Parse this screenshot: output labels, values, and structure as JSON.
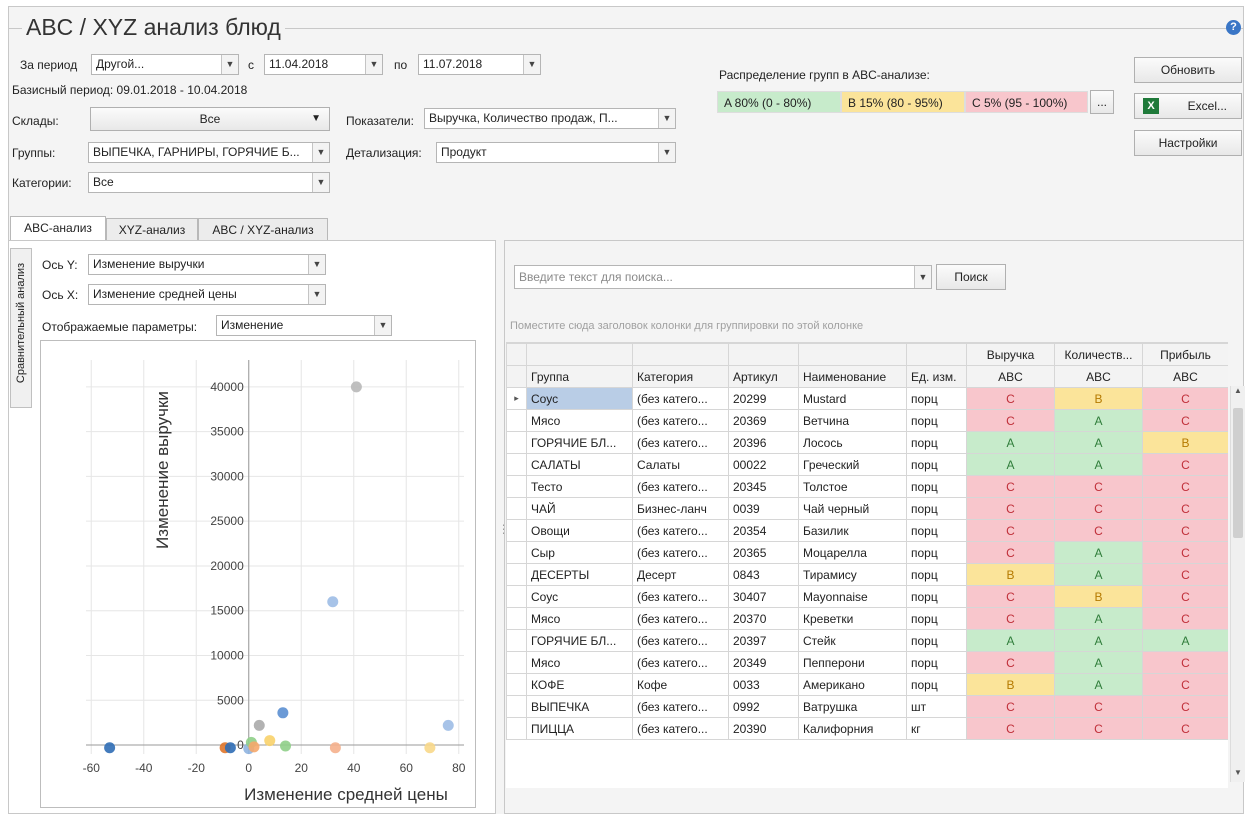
{
  "title": "ABC / XYZ анализ блюд",
  "help_icon": "?",
  "filters": {
    "period_label": "За период",
    "period_value": "Другой...",
    "from_label": "с",
    "from_value": "11.04.2018",
    "to_label": "по",
    "to_value": "11.07.2018",
    "base_period": "Базисный период: 09.01.2018 - 10.04.2018",
    "stores_label": "Склады:",
    "stores_value": "Все",
    "groups_label": "Группы:",
    "groups_value": "ВЫПЕЧКА, ГАРНИРЫ, ГОРЯЧИЕ Б...",
    "categories_label": "Категории:",
    "categories_value": "Все",
    "indicators_label": "Показатели:",
    "indicators_value": "Выручка, Количество продаж, П...",
    "detail_label": "Детализация:",
    "detail_value": "Продукт"
  },
  "distribution": {
    "label": "Распределение групп в ABC-анализе:",
    "a": "A 80% (0 - 80%)",
    "b": "B 15% (80 - 95%)",
    "c": "C 5% (95 - 100%)",
    "more": "...",
    "colors": {
      "A": "#c7ebcb",
      "B": "#fbe49a",
      "C": "#f8c6cc"
    }
  },
  "buttons": {
    "refresh": "Обновить",
    "excel": "Excel...",
    "settings": "Настройки"
  },
  "tabs": [
    "ABC-анализ",
    "XYZ-анализ",
    "ABC / XYZ-анализ"
  ],
  "left": {
    "vertical_tab": "Сравнительный анализ",
    "y_axis_label": "Ось Y:",
    "y_axis_value": "Изменение выручки",
    "x_axis_label": "Ось X:",
    "x_axis_value": "Изменение средней цены",
    "params_label": "Отображаемые параметры:",
    "params_value": "Изменение"
  },
  "chart_data": {
    "type": "scatter",
    "xlabel": "Изменение средней цены",
    "ylabel": "Изменение выручки",
    "xlim": [
      -62,
      82
    ],
    "ylim": [
      -1000,
      43000
    ],
    "xticks": [
      -60,
      -40,
      -20,
      0,
      20,
      40,
      60,
      80
    ],
    "yticks": [
      0,
      5000,
      10000,
      15000,
      20000,
      25000,
      30000,
      35000,
      40000
    ],
    "grid": true,
    "points": [
      {
        "x": -53,
        "y": -300,
        "color": "#2f6db5"
      },
      {
        "x": -9,
        "y": -300,
        "color": "#e0762a"
      },
      {
        "x": -7,
        "y": -300,
        "color": "#2f6db5"
      },
      {
        "x": 0,
        "y": -400,
        "color": "#8fb4e0"
      },
      {
        "x": 1,
        "y": 300,
        "color": "#8fcf88"
      },
      {
        "x": 2,
        "y": -200,
        "color": "#f5a86b"
      },
      {
        "x": 4,
        "y": 2200,
        "color": "#aaaaaa"
      },
      {
        "x": 8,
        "y": 500,
        "color": "#f8d26a"
      },
      {
        "x": 13,
        "y": 3600,
        "color": "#5b8fd1"
      },
      {
        "x": 14,
        "y": -100,
        "color": "#8fcf88"
      },
      {
        "x": 33,
        "y": -300,
        "color": "#f5b08c"
      },
      {
        "x": 32,
        "y": 16000,
        "color": "#9dbce6"
      },
      {
        "x": 41,
        "y": 40000,
        "color": "#b8b8b8"
      },
      {
        "x": 69,
        "y": -300,
        "color": "#f8d88a"
      },
      {
        "x": 76,
        "y": 2200,
        "color": "#9dbce6"
      }
    ]
  },
  "grid": {
    "search_placeholder": "Введите текст для поиска...",
    "search_button": "Поиск",
    "group_hint": "Поместите сюда заголовок колонки для группировки по этой колонке",
    "top_headers": [
      "Выручка",
      "Количеств...",
      "Прибыль"
    ],
    "columns": [
      "Группа",
      "Категория",
      "Артикул",
      "Наименование",
      "Ед. изм.",
      "ABC",
      "ABC",
      "ABC"
    ],
    "rows": [
      [
        "Соус",
        "(без катего...",
        "20299",
        "Mustard",
        "порц",
        "C",
        "B",
        "C"
      ],
      [
        "Мясо",
        "(без катего...",
        "20369",
        "Ветчина",
        "порц",
        "C",
        "A",
        "C"
      ],
      [
        "ГОРЯЧИЕ БЛ...",
        "(без катего...",
        "20396",
        "Лосось",
        "порц",
        "A",
        "A",
        "B"
      ],
      [
        "САЛАТЫ",
        "Салаты",
        "00022",
        "Греческий",
        "порц",
        "A",
        "A",
        "C"
      ],
      [
        "Тесто",
        "(без катего...",
        "20345",
        "Толстое",
        "порц",
        "C",
        "C",
        "C"
      ],
      [
        "ЧАЙ",
        "Бизнес-ланч",
        "0039",
        "Чай черный",
        "порц",
        "C",
        "C",
        "C"
      ],
      [
        "Овощи",
        "(без катего...",
        "20354",
        "Базилик",
        "порц",
        "C",
        "C",
        "C"
      ],
      [
        "Сыр",
        "(без катего...",
        "20365",
        "Моцарелла",
        "порц",
        "C",
        "A",
        "C"
      ],
      [
        "ДЕСЕРТЫ",
        "Десерт",
        "0843",
        "Тирамису",
        "порц",
        "B",
        "A",
        "C"
      ],
      [
        "Соус",
        "(без катего...",
        "30407",
        "Mayonnaise",
        "порц",
        "C",
        "B",
        "C"
      ],
      [
        "Мясо",
        "(без катего...",
        "20370",
        "Креветки",
        "порц",
        "C",
        "A",
        "C"
      ],
      [
        "ГОРЯЧИЕ БЛ...",
        "(без катего...",
        "20397",
        "Стейк",
        "порц",
        "A",
        "A",
        "A"
      ],
      [
        "Мясо",
        "(без катего...",
        "20349",
        "Пепперони",
        "порц",
        "C",
        "A",
        "C"
      ],
      [
        "КОФЕ",
        "Кофе",
        "0033",
        "Американо",
        "порц",
        "B",
        "A",
        "C"
      ],
      [
        "ВЫПЕЧКА",
        "(без катего...",
        "0992",
        "Ватрушка",
        "шт",
        "C",
        "C",
        "C"
      ],
      [
        "ПИЦЦА",
        "(без катего...",
        "20390",
        "Калифорния",
        "кг",
        "C",
        "C",
        "C"
      ]
    ]
  }
}
